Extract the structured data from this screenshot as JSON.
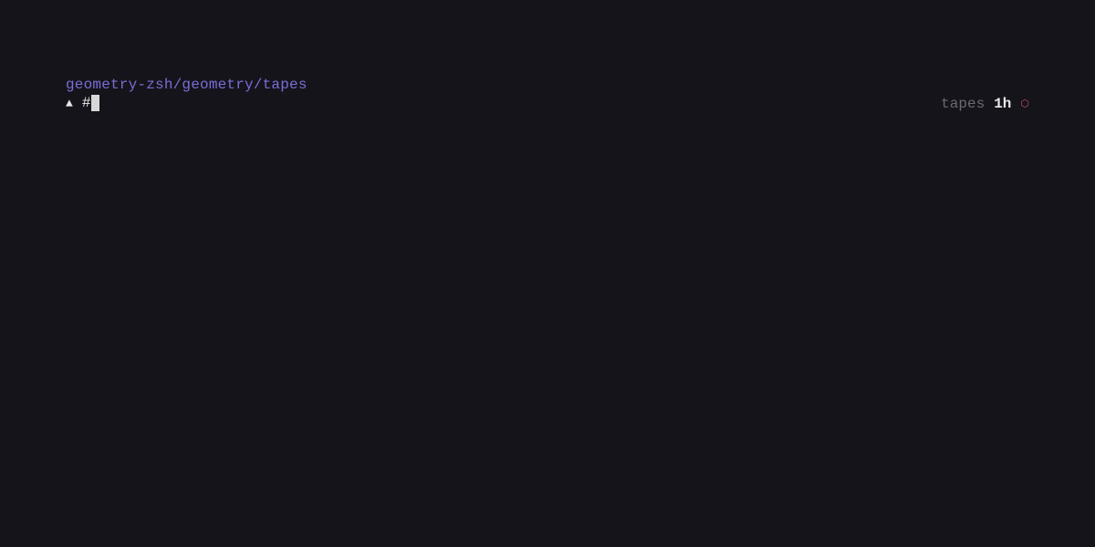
{
  "prompt": {
    "path": "geometry-zsh/geometry/tapes",
    "triangle": "▲",
    "hash": "#"
  },
  "status": {
    "branch": "tapes",
    "duration": "1h",
    "icon": "⬡"
  }
}
